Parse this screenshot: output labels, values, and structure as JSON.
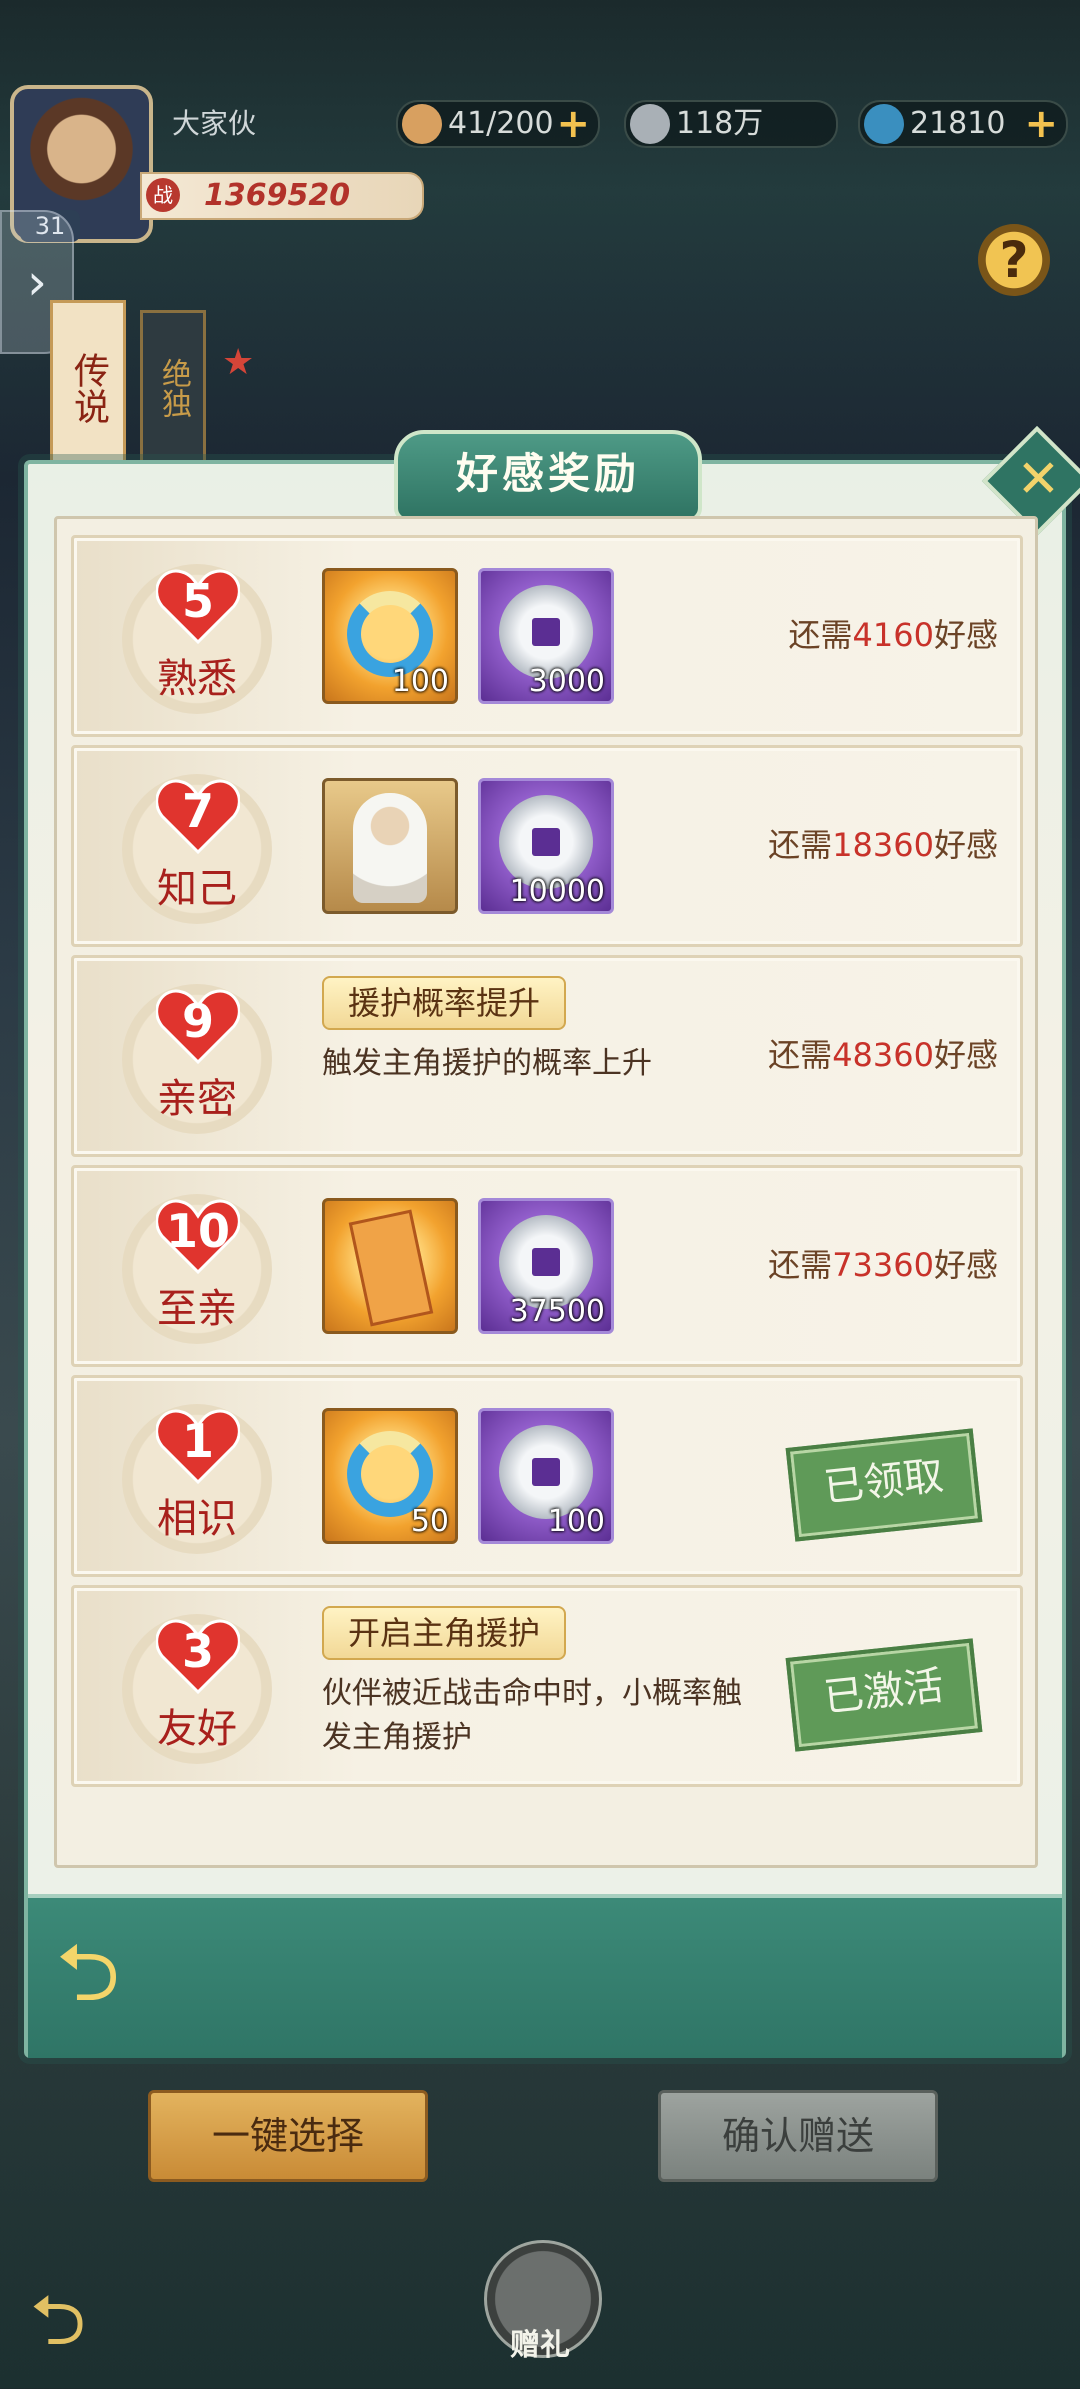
{
  "hud": {
    "player_name": "大家伙",
    "level": "31",
    "power": "1369520",
    "stamina": "41/200",
    "coins": "118万",
    "gems": "21810",
    "help": "?"
  },
  "background": {
    "banner1": "传说",
    "banner2": "绝独"
  },
  "dialog": {
    "title": "好感奖励",
    "rows": [
      {
        "level": "5",
        "label": "熟悉",
        "items": [
          {
            "qty": "100"
          },
          {
            "qty": "3000"
          }
        ],
        "need_prefix": "还需",
        "need_num": "4160",
        "need_suffix": "好感"
      },
      {
        "level": "7",
        "label": "知己",
        "items": [
          {
            "qty": ""
          },
          {
            "qty": "10000"
          }
        ],
        "need_prefix": "还需",
        "need_num": "18360",
        "need_suffix": "好感"
      },
      {
        "level": "9",
        "label": "亲密",
        "skill": "援护概率提升",
        "desc": "触发主角援护的概率上升",
        "need_prefix": "还需",
        "need_num": "48360",
        "need_suffix": "好感"
      },
      {
        "level": "10",
        "label": "至亲",
        "items": [
          {
            "qty": ""
          },
          {
            "qty": "37500"
          }
        ],
        "need_prefix": "还需",
        "need_num": "73360",
        "need_suffix": "好感"
      },
      {
        "level": "1",
        "label": "相识",
        "items": [
          {
            "qty": "50"
          },
          {
            "qty": "100"
          }
        ],
        "status": "已领取"
      },
      {
        "level": "3",
        "label": "友好",
        "skill": "开启主角援护",
        "desc": "伙伴被近战击命中时，小概率触发主角援护",
        "status": "已激活"
      }
    ]
  },
  "bottom": {
    "select_all": "一键选择",
    "confirm_gift": "确认赠送",
    "gift": "赠礼"
  }
}
